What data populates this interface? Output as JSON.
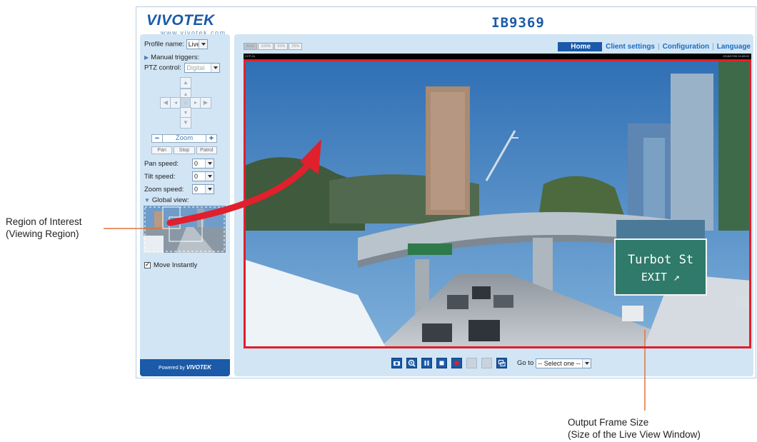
{
  "header": {
    "logo_text": "VIVOTEK",
    "logo_url": "www.vivotek.com",
    "model": "IB9369"
  },
  "sidebar": {
    "profile_label": "Profile name:",
    "profile_value": "Live",
    "manual_triggers": "Manual triggers:",
    "ptz_label": "PTZ control:",
    "ptz_value": "Digital",
    "zoom_label": "Zoom",
    "zoom_minus": "−",
    "zoom_plus": "+",
    "pan_btn": "Pan",
    "stop_btn": "Stop",
    "patrol_btn": "Patrol",
    "pan_speed_label": "Pan speed:",
    "pan_speed_value": "0",
    "tilt_speed_label": "Tilt speed:",
    "tilt_speed_value": "0",
    "zoom_speed_label": "Zoom speed:",
    "zoom_speed_value": "0",
    "global_view": "Global view:",
    "move_instantly": "Move Instantly",
    "move_instantly_checked": true,
    "powered_by": "Powered by",
    "powered_brand": "VIVOTEK"
  },
  "main": {
    "size_tabs": [
      "Auto",
      "100%",
      "50%",
      "25%"
    ],
    "active_size_tab": "Auto",
    "menu": {
      "home": "Home",
      "client_settings": "Client settings",
      "configuration": "Configuration",
      "language": "Language"
    },
    "osd_left": "CCP-01",
    "osd_right": "2015/07/09 10:45:02",
    "sign_line1": "Turbot St",
    "sign_line2": "EXIT ↗",
    "toolbar_icons": [
      "camera-icon",
      "zoom-icon",
      "pause-icon",
      "stop-icon",
      "record-icon",
      "volume-icon",
      "mic-icon",
      "fullscreen-icon"
    ],
    "goto_label": "Go to",
    "goto_value": "-- Select one --"
  },
  "annotations": {
    "roi_line1": "Region of Interest",
    "roi_line2": "(Viewing Region)",
    "output_line1": "Output Frame Size",
    "output_line2": "(Size of the Live View Window)"
  },
  "colors": {
    "brand_blue": "#1a5aa8",
    "panel_bg": "#d2e5f4",
    "roi_red": "#e0202c",
    "callout_orange": "#e0743a"
  }
}
